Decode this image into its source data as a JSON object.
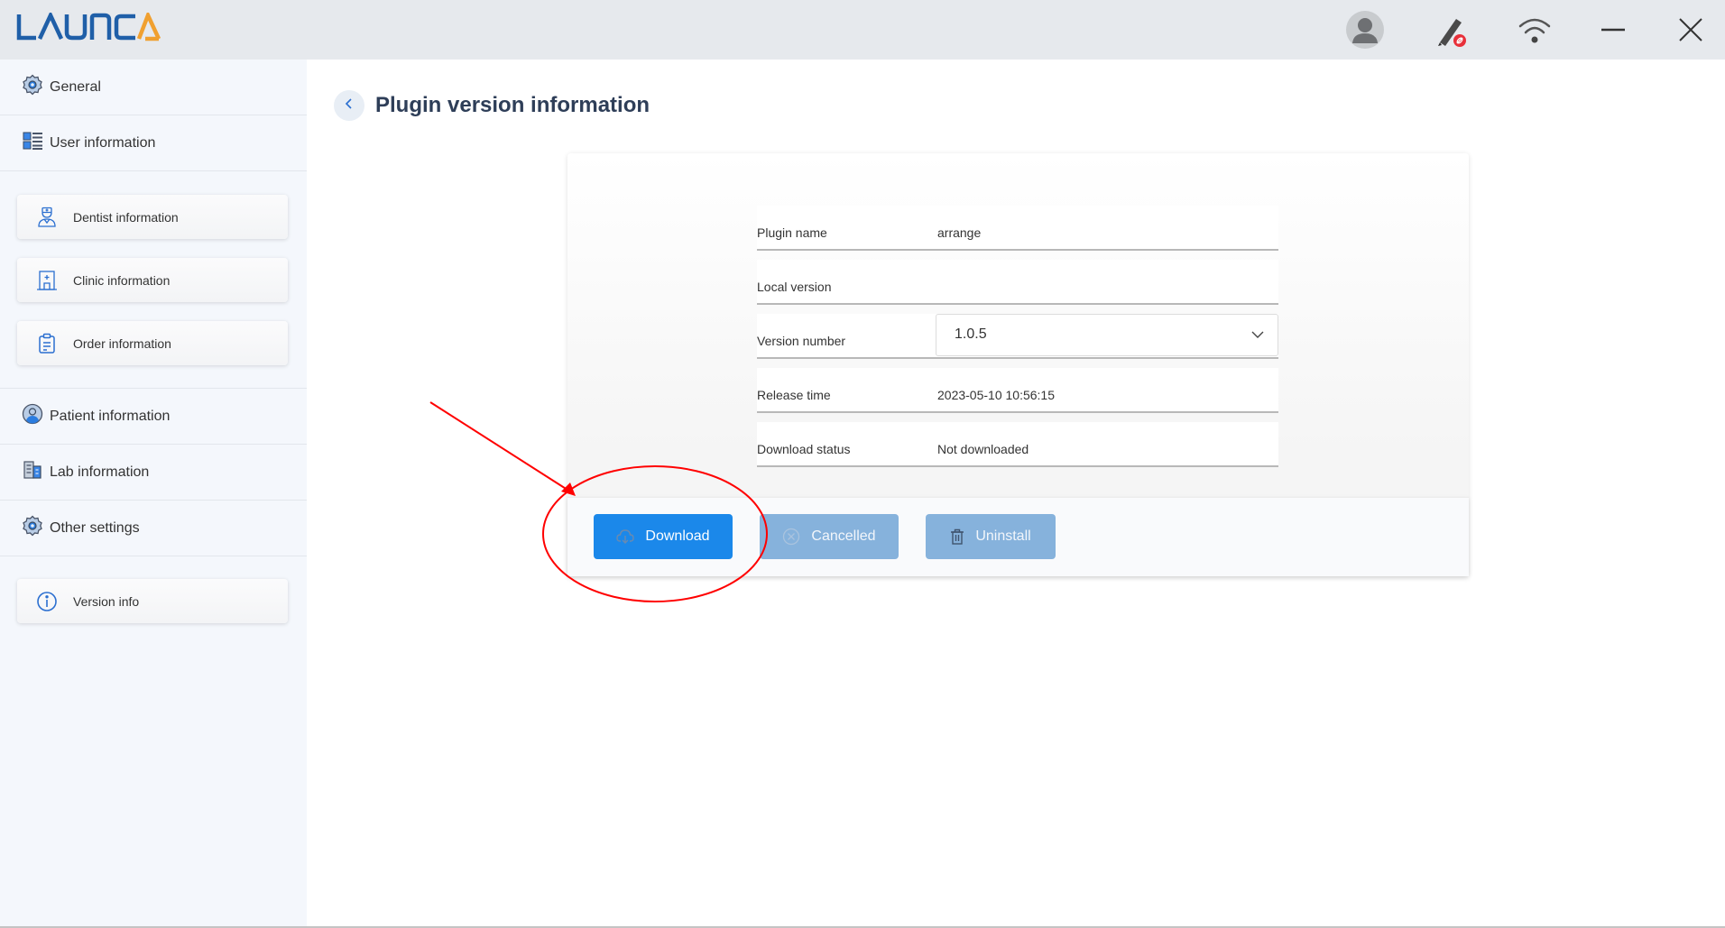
{
  "app": {
    "logo_main": "LAUNC",
    "logo_accent": "A",
    "brand_color": "#1f5fa8",
    "accent_color": "#f0a030"
  },
  "header": {
    "icons": [
      "avatar-icon",
      "pen-disconnected-icon",
      "wifi-icon",
      "minimize-icon",
      "close-icon"
    ]
  },
  "sidebar": {
    "items": [
      {
        "label": "General",
        "icon": "gear-icon"
      },
      {
        "label": "User information",
        "icon": "list-grid-icon"
      },
      {
        "label": "Dentist information",
        "icon": "dentist-icon",
        "sub": true
      },
      {
        "label": "Clinic information",
        "icon": "clinic-icon",
        "sub": true
      },
      {
        "label": "Order information",
        "icon": "clipboard-icon",
        "sub": true
      },
      {
        "label": "Patient information",
        "icon": "patient-icon"
      },
      {
        "label": "Lab information",
        "icon": "building-icon"
      },
      {
        "label": "Other settings",
        "icon": "gear-icon"
      },
      {
        "label": "Version info",
        "icon": "info-icon",
        "sub": true
      }
    ]
  },
  "main": {
    "title": "Plugin version information",
    "fields": [
      {
        "label": "Plugin name",
        "value": "arrange"
      },
      {
        "label": "Local version",
        "value": ""
      },
      {
        "label": "Version number",
        "value": "1.0.5"
      },
      {
        "label": "Release time",
        "value": "2023-05-10 10:56:15"
      },
      {
        "label": "Download status",
        "value": "Not downloaded"
      }
    ],
    "buttons": {
      "download": "Download",
      "cancelled": "Cancelled",
      "uninstall": "Uninstall"
    },
    "primary_color": "#1b88ea",
    "disabled_color": "#86b2dc"
  },
  "annotation": {
    "color": "#ff0000",
    "target": "download-button"
  }
}
